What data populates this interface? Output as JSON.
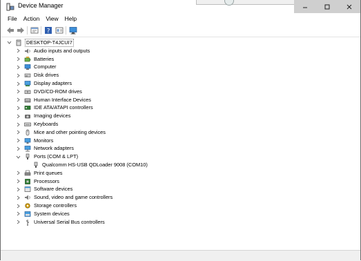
{
  "window": {
    "title": "Device Manager"
  },
  "menu": [
    "File",
    "Action",
    "View",
    "Help"
  ],
  "toolbar": {
    "buttons": [
      "back-icon",
      "forward-icon",
      "properties-icon",
      "help-icon",
      "details-icon",
      "scan-hardware-icon"
    ]
  },
  "tree": {
    "root": "DESKTOP-T4JCUI7",
    "categories": [
      {
        "label": "Audio inputs and outputs",
        "icon": "speaker-icon"
      },
      {
        "label": "Batteries",
        "icon": "battery-icon"
      },
      {
        "label": "Computer",
        "icon": "computer-icon"
      },
      {
        "label": "Disk drives",
        "icon": "disk-drive-icon"
      },
      {
        "label": "Display adapters",
        "icon": "display-adapter-icon"
      },
      {
        "label": "DVD/CD-ROM drives",
        "icon": "dvd-icon"
      },
      {
        "label": "Human Interface Devices",
        "icon": "hid-icon"
      },
      {
        "label": "IDE ATA/ATAPI controllers",
        "icon": "ide-controller-icon"
      },
      {
        "label": "Imaging devices",
        "icon": "camera-icon"
      },
      {
        "label": "Keyboards",
        "icon": "keyboard-icon"
      },
      {
        "label": "Mice and other pointing devices",
        "icon": "mouse-icon"
      },
      {
        "label": "Monitors",
        "icon": "monitor-icon"
      },
      {
        "label": "Network adapters",
        "icon": "network-icon"
      },
      {
        "label": "Ports (COM & LPT)",
        "icon": "port-icon",
        "expanded": true
      },
      {
        "label": "Qualcomm HS-USB QDLoader 9008 (COM10)",
        "icon": "port-device-icon",
        "child": true
      },
      {
        "label": "Print queues",
        "icon": "printer-icon"
      },
      {
        "label": "Processors",
        "icon": "processor-icon"
      },
      {
        "label": "Software devices",
        "icon": "software-device-icon"
      },
      {
        "label": "Sound, video and game controllers",
        "icon": "sound-icon"
      },
      {
        "label": "Storage controllers",
        "icon": "storage-controller-icon"
      },
      {
        "label": "System devices",
        "icon": "system-device-icon"
      },
      {
        "label": "Universal Serial Bus controllers",
        "icon": "usb-icon"
      }
    ]
  }
}
